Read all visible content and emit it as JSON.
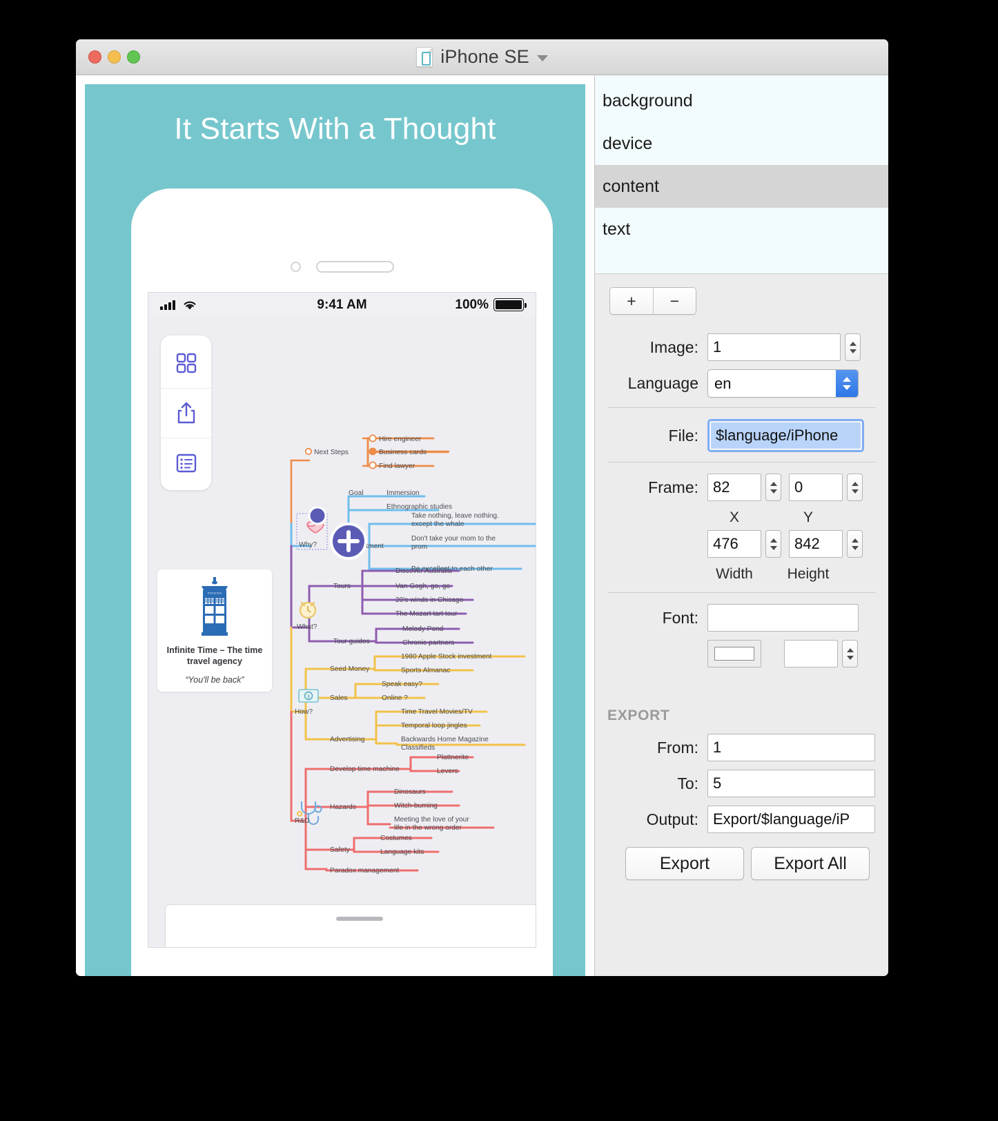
{
  "window": {
    "title": "iPhone SE",
    "doc_icon": "document-icon",
    "chevron": "chevron-down-icon"
  },
  "traffic_lights": {
    "close": "close",
    "minimize": "minimize",
    "zoom": "zoom"
  },
  "poster": {
    "headline": "It Starts With a Thought",
    "background_color": "#76c7cd"
  },
  "status_bar": {
    "time": "9:41 AM",
    "battery_percent": "100%",
    "signal_icon": "cellular-signal-icon",
    "wifi_icon": "wifi-icon",
    "battery_icon": "battery-icon"
  },
  "rail": {
    "items": [
      {
        "icon": "grid-icon",
        "name": "grid-view-button"
      },
      {
        "icon": "share-icon",
        "name": "share-button"
      },
      {
        "icon": "list-icon",
        "name": "outline-list-button"
      }
    ]
  },
  "tardis_card": {
    "caption": "Infinite Time – The time travel agency",
    "quote": "“You'll be back”",
    "icon": "tardis-police-box-icon"
  },
  "mindmap": {
    "central_node": "plus-node",
    "branches": [
      {
        "title": "Next Steps",
        "color": "#ee8b49",
        "children": [
          {
            "label": "Hire engineer",
            "checked": false
          },
          {
            "label": "Business cards",
            "checked": true
          },
          {
            "label": "Find lawyer",
            "checked": false
          }
        ]
      },
      {
        "title": "Why?",
        "icon": "heart-icon",
        "color": "#6fbdec",
        "groups": [
          {
            "label": "Goal",
            "children": [
              "Immersion",
              "Ethnographic studies"
            ]
          },
          {
            "label": "itment",
            "children": [
              "Take nothing, leave nothing. except the whale",
              "Don't take your mom to the prom",
              "Be excellent to each other"
            ]
          }
        ]
      },
      {
        "title": "What?",
        "icon": "alarm-clock-icon",
        "color": "#8e5cb0",
        "groups": [
          {
            "label": "Tours",
            "children": [
              "Discover Australia",
              "Van Gogh, go, go",
              "20's winds in Chicago",
              "The Mozart tart tour"
            ]
          },
          {
            "label": "Tour guides",
            "children": [
              "Melody Pond",
              "Chronic partners"
            ]
          }
        ]
      },
      {
        "title": "How?",
        "icon": "money-icon",
        "color": "#f2c14b",
        "groups": [
          {
            "label": "Seed Money",
            "children": [
              "1980 Apple Stock investment",
              "Sports Almanac"
            ]
          },
          {
            "label": "Sales",
            "children": [
              "Speak easy?",
              "Online ?"
            ]
          },
          {
            "label": "Advertising",
            "children": [
              "Time Travel Movies/TV",
              "Temporal loop jingles",
              "Backwards Home Magazine Classifieds"
            ]
          }
        ]
      },
      {
        "title": "R&D",
        "icon": "stethoscope-icon",
        "color": "#ef6d6d",
        "groups": [
          {
            "label": "Develop time machine",
            "children": [
              "Plattnerite",
              "Levers"
            ]
          },
          {
            "label": "Hazards",
            "children": [
              "Dinosaurs",
              "Witch-burning",
              "Meeting the love of your life in the wrong order"
            ]
          },
          {
            "label": "Safety",
            "children": [
              "Costumes",
              "Language kits"
            ]
          },
          {
            "label": "Paradox management",
            "children": []
          }
        ]
      }
    ]
  },
  "inspector": {
    "layers": [
      {
        "label": "background",
        "selected": false
      },
      {
        "label": "device",
        "selected": false
      },
      {
        "label": "content",
        "selected": true
      },
      {
        "label": "text",
        "selected": false
      }
    ],
    "layer_tools": {
      "add": "+",
      "remove": "−"
    },
    "fields": {
      "image_label": "Image:",
      "image_value": "1",
      "language_label": "Language",
      "language_value": "en",
      "file_label": "File:",
      "file_value": "$language/iPhone",
      "frame_label": "Frame:",
      "frame_x": "82",
      "frame_y": "0",
      "frame_x_sub": "X",
      "frame_y_sub": "Y",
      "frame_w": "476",
      "frame_h": "842",
      "frame_w_sub": "Width",
      "frame_h_sub": "Height",
      "font_label": "Font:",
      "font_value": "",
      "font_color_value": "",
      "font_size_value": ""
    },
    "export": {
      "heading": "EXPORT",
      "from_label": "From:",
      "from_value": "1",
      "to_label": "To:",
      "to_value": "5",
      "output_label": "Output:",
      "output_value": "Export/$language/iP",
      "export_button": "Export",
      "export_all_button": "Export All"
    }
  }
}
